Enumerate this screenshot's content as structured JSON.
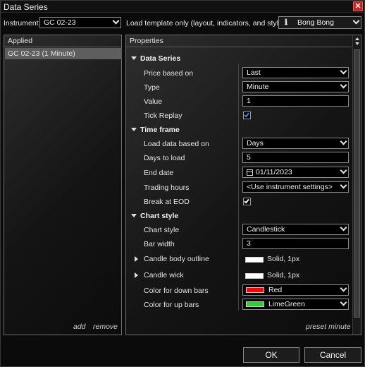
{
  "window": {
    "title": "Data Series",
    "close_glyph": "✕"
  },
  "top": {
    "instrument_label": "Instrument",
    "instrument_value": "GC 02-23",
    "template_label": "Load template only (layout, indicators, and style)",
    "template_value": "Bong Bong"
  },
  "applied": {
    "header": "Applied",
    "items": [
      "GC 02-23 (1 Minute)"
    ],
    "add_label": "add",
    "remove_label": "remove"
  },
  "properties": {
    "header": "Properties",
    "footer_link": "preset minute",
    "data_series": {
      "title": "Data Series",
      "price_based_on_label": "Price based on",
      "price_based_on_value": "Last",
      "type_label": "Type",
      "type_value": "Minute",
      "value_label": "Value",
      "value_value": "1",
      "tick_replay_label": "Tick Replay",
      "tick_replay_checked": true
    },
    "time_frame": {
      "title": "Time frame",
      "load_data_label": "Load data based on",
      "load_data_value": "Days",
      "days_to_load_label": "Days to load",
      "days_to_load_value": "5",
      "end_date_label": "End date",
      "end_date_value": "01/11/2023",
      "trading_hours_label": "Trading hours",
      "trading_hours_value": "<Use instrument settings>",
      "break_eod_label": "Break at EOD",
      "break_eod_checked": true
    },
    "chart_style": {
      "title": "Chart style",
      "chart_style_label": "Chart style",
      "chart_style_value": "Candlestick",
      "bar_width_label": "Bar width",
      "bar_width_value": "3",
      "candle_body_label": "Candle body outline",
      "candle_body_value": "Solid, 1px",
      "candle_body_color": "#ffffff",
      "candle_wick_label": "Candle wick",
      "candle_wick_value": "Solid, 1px",
      "candle_wick_color": "#ffffff",
      "down_bars_label": "Color for down bars",
      "down_bars_value": "Red",
      "down_bars_color": "#ff0000",
      "up_bars_label": "Color for up bars",
      "up_bars_value": "LimeGreen",
      "up_bars_color": "#32cd32"
    }
  },
  "buttons": {
    "ok": "OK",
    "cancel": "Cancel"
  }
}
